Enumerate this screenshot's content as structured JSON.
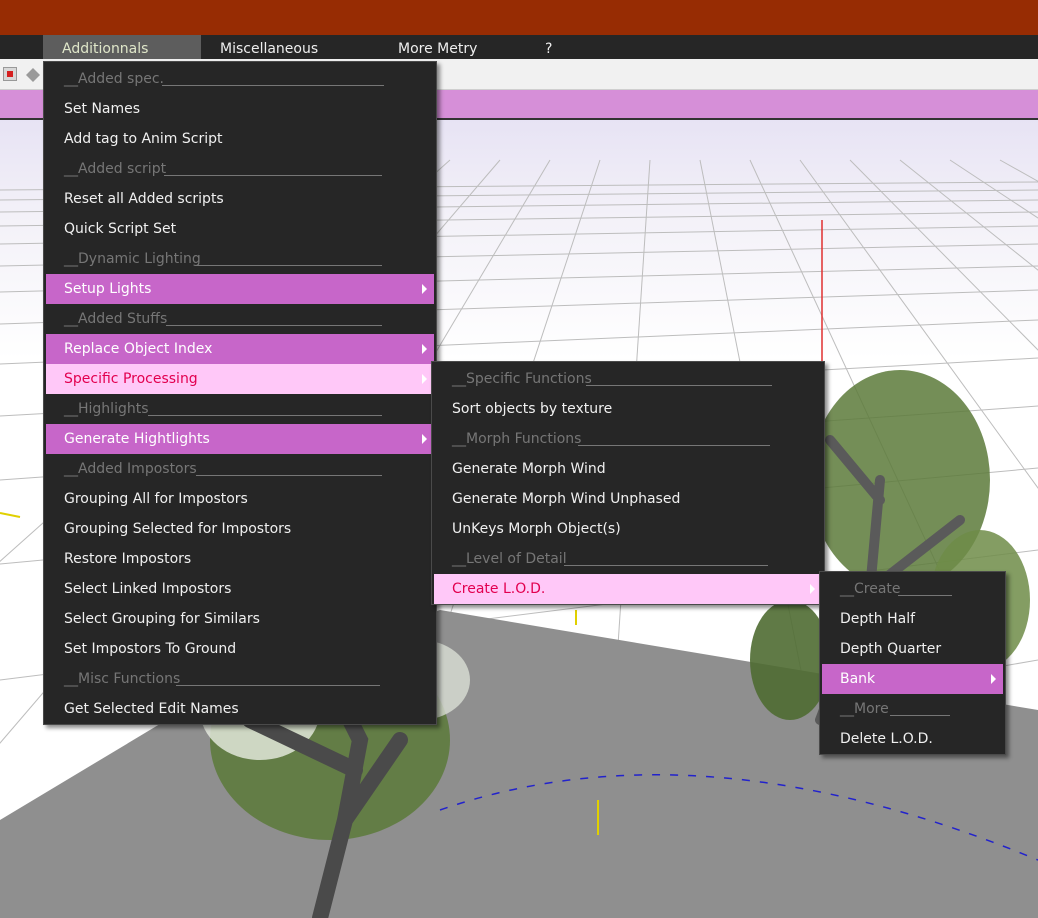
{
  "menubar": {
    "items": [
      {
        "label": "Additionnals"
      },
      {
        "label": "Miscellaneous"
      },
      {
        "label": "More Metry"
      },
      {
        "label": "?"
      }
    ]
  },
  "main_menu": {
    "items": [
      {
        "label": "__Added spec.",
        "kind": "separator"
      },
      {
        "label": "Set Names",
        "kind": "item"
      },
      {
        "label": "Add tag to Anim Script",
        "kind": "item"
      },
      {
        "label": "__Added script",
        "kind": "separator"
      },
      {
        "label": "Reset all Added scripts",
        "kind": "item"
      },
      {
        "label": "Quick Script Set",
        "kind": "item"
      },
      {
        "label": "__Dynamic Lighting",
        "kind": "separator"
      },
      {
        "label": "Setup Lights",
        "kind": "submenu"
      },
      {
        "label": "__Added Stuffs",
        "kind": "separator"
      },
      {
        "label": "Replace Object Index",
        "kind": "submenu"
      },
      {
        "label": "Specific Processing",
        "kind": "submenu-open"
      },
      {
        "label": "__Highlights",
        "kind": "separator"
      },
      {
        "label": "Generate Hightlights",
        "kind": "submenu"
      },
      {
        "label": "__Added Impostors",
        "kind": "separator"
      },
      {
        "label": "Grouping All for Impostors",
        "kind": "item"
      },
      {
        "label": "Grouping Selected for Impostors",
        "kind": "item"
      },
      {
        "label": "Restore Impostors",
        "kind": "item"
      },
      {
        "label": "Select Linked Impostors",
        "kind": "item"
      },
      {
        "label": "Select Grouping for Similars",
        "kind": "item"
      },
      {
        "label": "Set Impostors To Ground",
        "kind": "item"
      },
      {
        "label": "__Misc Functions",
        "kind": "separator"
      },
      {
        "label": "Get Selected Edit Names",
        "kind": "item"
      }
    ]
  },
  "specific_menu": {
    "items": [
      {
        "label": "__Specific Functions",
        "kind": "separator"
      },
      {
        "label": "Sort objects by texture",
        "kind": "item"
      },
      {
        "label": "__Morph Functions",
        "kind": "separator"
      },
      {
        "label": "Generate Morph Wind",
        "kind": "item"
      },
      {
        "label": "Generate Morph Wind Unphased",
        "kind": "item"
      },
      {
        "label": "UnKeys Morph Object(s)",
        "kind": "item"
      },
      {
        "label": "__Level of Detail",
        "kind": "separator"
      },
      {
        "label": "Create L.O.D.",
        "kind": "submenu-open"
      }
    ]
  },
  "lod_menu": {
    "items": [
      {
        "label": "__Create",
        "kind": "separator"
      },
      {
        "label": "Depth Half",
        "kind": "item"
      },
      {
        "label": "Depth Quarter",
        "kind": "item"
      },
      {
        "label": "Bank",
        "kind": "submenu"
      },
      {
        "label": "__More",
        "kind": "separator"
      },
      {
        "label": "Delete L.O.D.",
        "kind": "item"
      }
    ]
  },
  "colors": {
    "titlebar": "#972c03",
    "menu_bg": "#262626",
    "highlight": "#c766c9",
    "open_path": "#ffc8f8",
    "open_path_text": "#e2004f",
    "pink_toolbar": "#d68fd8"
  }
}
